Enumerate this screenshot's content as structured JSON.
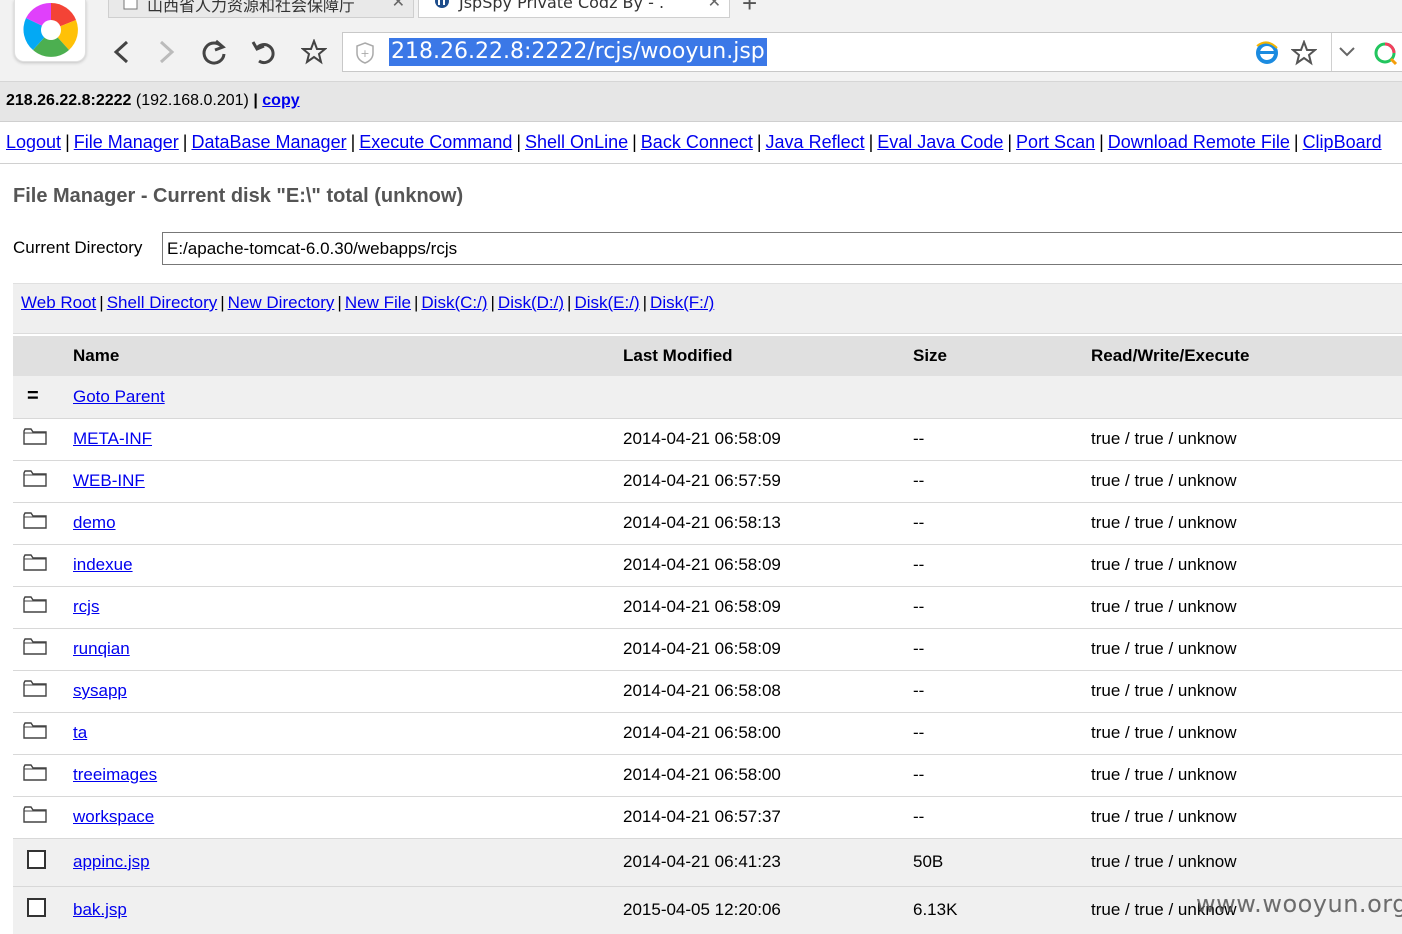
{
  "browser": {
    "tabs": [
      {
        "title": "山西省人力资源和社会保障厅",
        "active": false
      },
      {
        "title": "JspSpy Private Codz By - .",
        "active": true
      }
    ],
    "url": "218.26.22.8:2222/rcjs/wooyun.jsp"
  },
  "host": {
    "address": "218.26.22.8:2222",
    "internal_ip": "(192.168.0.201)",
    "separator": "|",
    "copy_label": "copy"
  },
  "menu": {
    "items": [
      "Logout",
      "File Manager",
      "DataBase Manager",
      "Execute Command",
      "Shell OnLine",
      "Back Connect",
      "Java Reflect",
      "Eval Java Code",
      "Port Scan",
      "Download Remote File",
      "ClipBoard"
    ]
  },
  "file_manager": {
    "title": "File Manager - Current disk \"E:\\\" total (unknow)",
    "current_directory_label": "Current Directory",
    "current_directory_value": "E:/apache-tomcat-6.0.30/webapps/rcjs",
    "quick_links": [
      "Web Root",
      "Shell Directory",
      "New Directory",
      "New File",
      "Disk(C:/)",
      "Disk(D:/)",
      "Disk(E:/)",
      "Disk(F:/)"
    ],
    "columns": [
      "Name",
      "Last Modified",
      "Size",
      "Read/Write/Execute"
    ],
    "parent_icon": "=",
    "parent_label": "Goto Parent",
    "rows": [
      {
        "type": "folder",
        "name": "META-INF",
        "modified": "2014-04-21 06:58:09",
        "size": "--",
        "perms": "true / true / unknow"
      },
      {
        "type": "folder",
        "name": "WEB-INF",
        "modified": "2014-04-21 06:57:59",
        "size": "--",
        "perms": "true / true / unknow"
      },
      {
        "type": "folder",
        "name": "demo",
        "modified": "2014-04-21 06:58:13",
        "size": "--",
        "perms": "true / true / unknow"
      },
      {
        "type": "folder",
        "name": "indexue",
        "modified": "2014-04-21 06:58:09",
        "size": "--",
        "perms": "true / true / unknow"
      },
      {
        "type": "folder",
        "name": "rcjs",
        "modified": "2014-04-21 06:58:09",
        "size": "--",
        "perms": "true / true / unknow"
      },
      {
        "type": "folder",
        "name": "runqian",
        "modified": "2014-04-21 06:58:09",
        "size": "--",
        "perms": "true / true / unknow"
      },
      {
        "type": "folder",
        "name": "sysapp",
        "modified": "2014-04-21 06:58:08",
        "size": "--",
        "perms": "true / true / unknow"
      },
      {
        "type": "folder",
        "name": "ta",
        "modified": "2014-04-21 06:58:00",
        "size": "--",
        "perms": "true / true / unknow"
      },
      {
        "type": "folder",
        "name": "treeimages",
        "modified": "2014-04-21 06:58:00",
        "size": "--",
        "perms": "true / true / unknow"
      },
      {
        "type": "folder",
        "name": "workspace",
        "modified": "2014-04-21 06:57:37",
        "size": "--",
        "perms": "true / true / unknow"
      },
      {
        "type": "file",
        "name": "appinc.jsp",
        "modified": "2014-04-21 06:41:23",
        "size": "50B",
        "perms": "true / true / unknow"
      },
      {
        "type": "file",
        "name": "bak.jsp",
        "modified": "2015-04-05 12:20:06",
        "size": "6.13K",
        "perms": "true / true / unknow"
      }
    ]
  },
  "watermark": "www.wooyun.org",
  "colors": {
    "link": "#0000ee",
    "url_highlight": "#3b78e7",
    "header_bg": "#e0e0e0"
  }
}
